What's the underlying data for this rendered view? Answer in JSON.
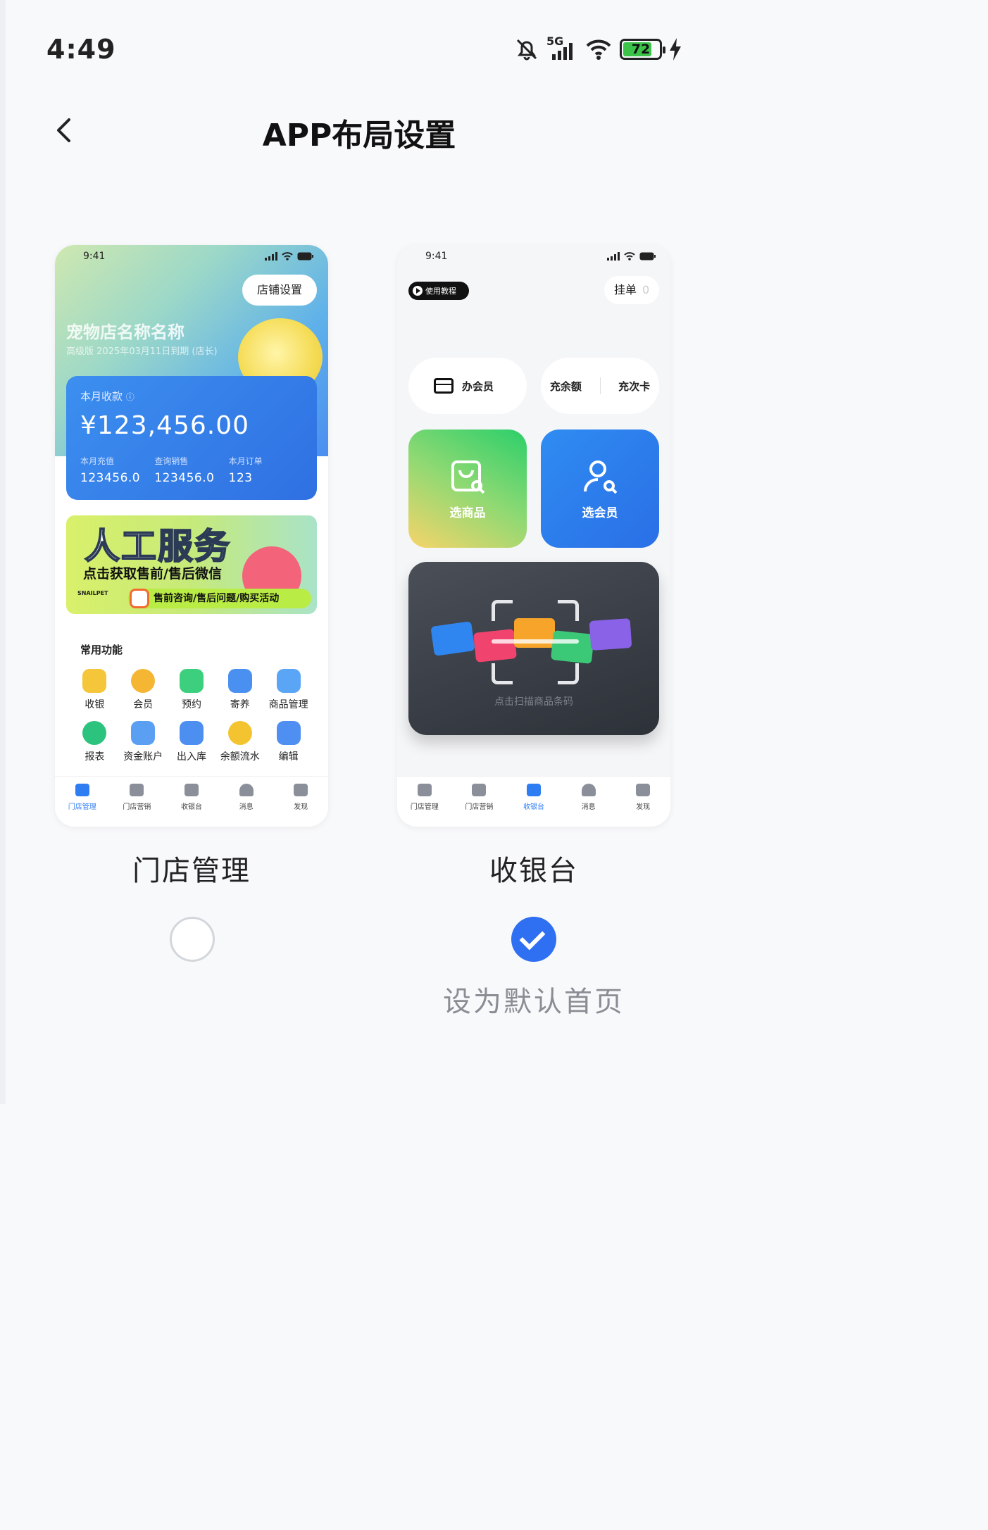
{
  "status_bar": {
    "time": "4:49",
    "network": "5G",
    "battery": "72"
  },
  "header": {
    "title": "APP布局设置"
  },
  "layout_options": [
    {
      "caption": "门店管理",
      "selected": false,
      "preview": {
        "time": "9:41",
        "shop_settings": "店铺设置",
        "shop_name": "宠物店名称名称",
        "shop_sub": "高级版 2025年03月11日到期 (店长)",
        "revenue_label": "本月收款",
        "revenue_amount": "¥123,456.00",
        "stats": [
          {
            "label": "本月充值",
            "value": "123456.0"
          },
          {
            "label": "查询销售",
            "value": "123456.0"
          },
          {
            "label": "本月订单",
            "value": "123"
          }
        ],
        "banner": {
          "headline": "人工服务",
          "subline": "点击获取售前/售后微信",
          "pill": "售前咨询/售后问题/购买活动",
          "brand": "SNAILPET"
        },
        "functions_title": "常用功能",
        "functions": [
          {
            "label": "收银",
            "icon": "cashier-icon",
            "color": "#f5c53a"
          },
          {
            "label": "会员",
            "icon": "member-icon",
            "color": "#f5b634"
          },
          {
            "label": "预约",
            "icon": "calendar-icon",
            "color": "#3ccf7e"
          },
          {
            "label": "寄养",
            "icon": "house-icon",
            "color": "#4a90f0"
          },
          {
            "label": "商品管理",
            "icon": "bag-icon",
            "color": "#5aa5f5"
          },
          {
            "label": "报表",
            "icon": "pie-chart-icon",
            "color": "#2bc37d"
          },
          {
            "label": "资金账户",
            "icon": "wallet-icon",
            "color": "#5b9ff2"
          },
          {
            "label": "出入库",
            "icon": "warehouse-icon",
            "color": "#4d8ff0"
          },
          {
            "label": "余额流水",
            "icon": "coin-icon",
            "color": "#f4c430"
          },
          {
            "label": "编辑",
            "icon": "grid-icon",
            "color": "#4f8ff2"
          }
        ],
        "tabs": [
          "门店管理",
          "门店营销",
          "收银台",
          "消息",
          "发现"
        ],
        "active_tab": 0
      }
    },
    {
      "caption": "收银台",
      "selected": true,
      "preview": {
        "time": "9:41",
        "tutorial": "使用教程",
        "hang_order": "挂单",
        "hang_count": "0",
        "membership": "办会员",
        "recharge_balance": "充余额",
        "recharge_card": "充次卡",
        "select_goods": "选商品",
        "select_member": "选会员",
        "scan_text": "点击扫描商品条码",
        "tabs": [
          "门店管理",
          "门店营销",
          "收银台",
          "消息",
          "发现"
        ],
        "active_tab": 2
      }
    }
  ],
  "default_label": "设为默认首页",
  "colors": {
    "accent": "#2f6ff2",
    "unselected_ring": "#d3d6db"
  }
}
